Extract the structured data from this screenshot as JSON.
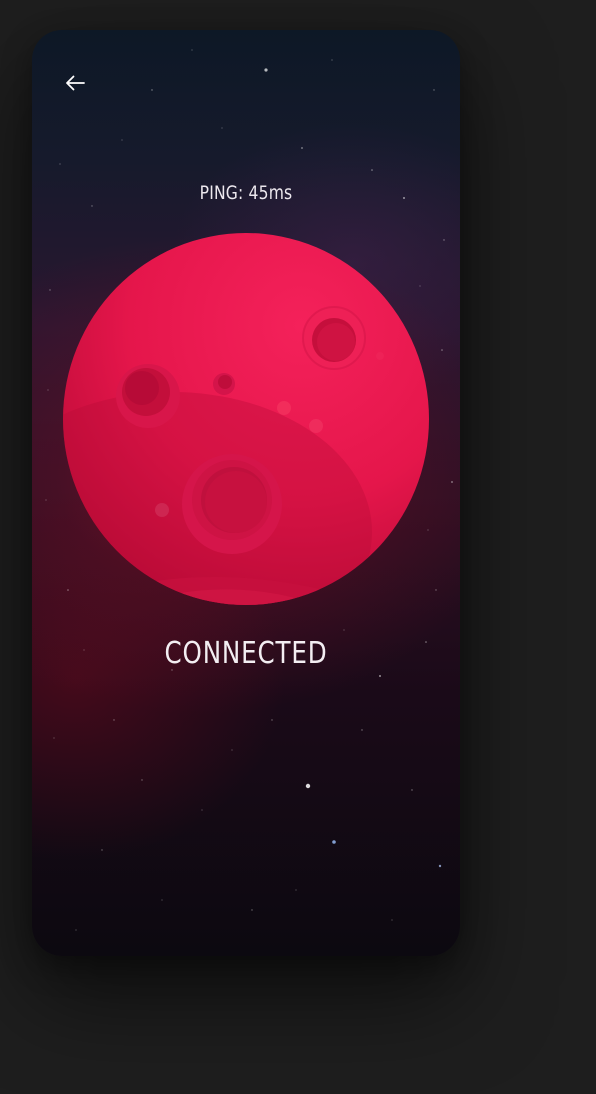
{
  "screen": {
    "ping_text": "PING: 45ms",
    "status_text": "CONNECTED"
  },
  "icons": {
    "back": "arrow-left-icon",
    "planet": "planet-illustration"
  },
  "colors": {
    "planet": "#ea1b4f",
    "planet_shadow": "#c20f3b",
    "text": "#f3eef2"
  }
}
